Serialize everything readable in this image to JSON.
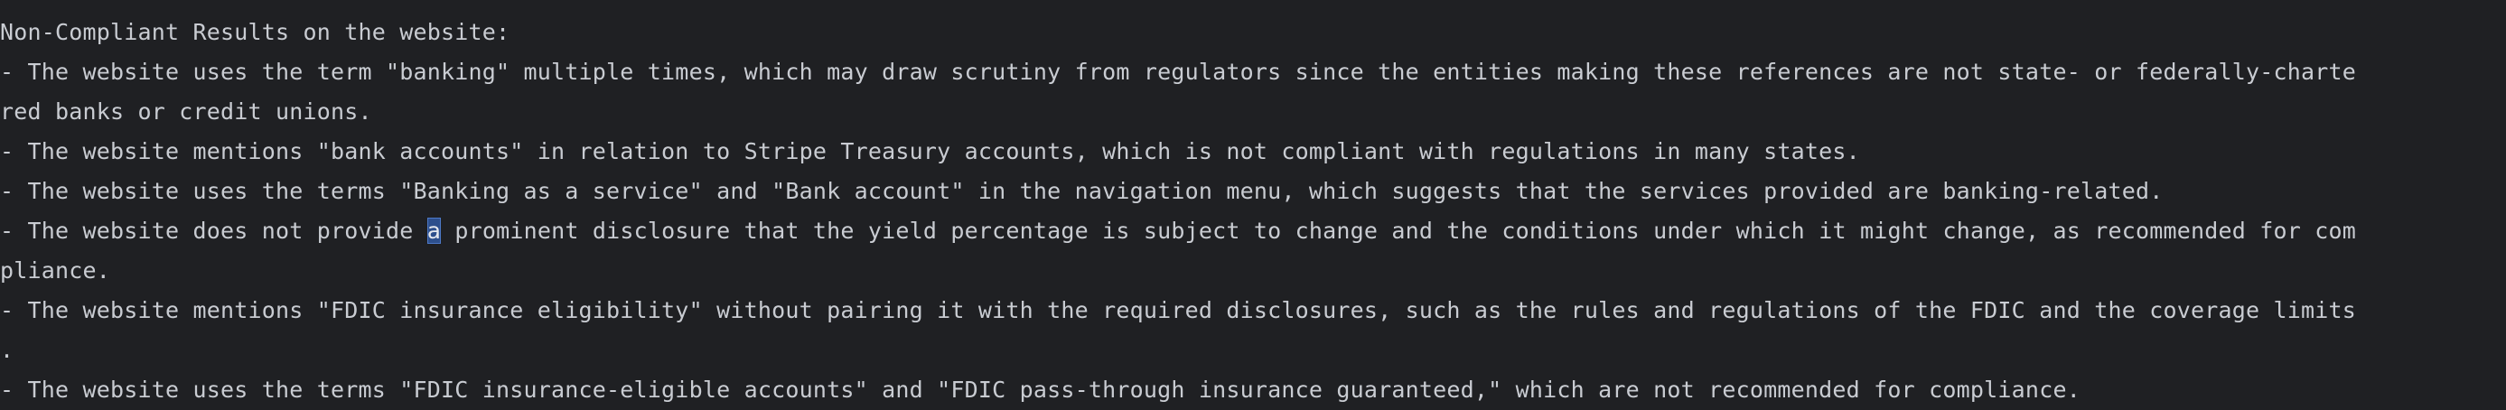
{
  "output": {
    "lines": [
      "Non-Compliant Results on the website:",
      "- The website uses the term \"banking\" multiple times, which may draw scrutiny from regulators since the entities making these references are not state- or federally-charte",
      "red banks or credit unions.",
      "- The website mentions \"bank accounts\" in relation to Stripe Treasury accounts, which is not compliant with regulations in many states.",
      "- The website uses the terms \"Banking as a service\" and \"Bank account\" in the navigation menu, which suggests that the services provided are banking-related.",
      "- The website does not provide ",
      "pliance.",
      "- The website mentions \"FDIC insurance eligibility\" without pairing it with the required disclosures, such as the rules and regulations of the FDIC and the coverage limits",
      ".",
      "- The website uses the terms \"FDIC insurance-eligible accounts\" and \"FDIC pass-through insurance guaranteed,\" which are not recommended for compliance."
    ],
    "cursor_line": {
      "before": "- The website does not provide ",
      "cursor_char": "a",
      "after": " prominent disclosure that the yield percentage is subject to change and the conditions under which it might change, as recommended for com"
    }
  },
  "colors": {
    "background": "#1f2023",
    "text": "#c9ccd2",
    "cursor_highlight": "#2d4f8c"
  }
}
